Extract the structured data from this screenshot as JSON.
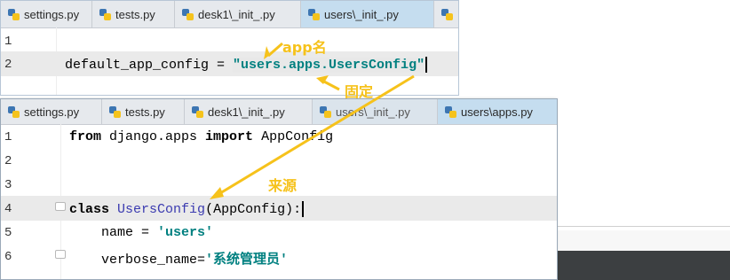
{
  "editor_top": {
    "tabs": [
      {
        "label": "settings.py",
        "active": false
      },
      {
        "label": "tests.py",
        "active": false
      },
      {
        "label": "desk1\\_init_.py",
        "active": false
      },
      {
        "label": "users\\_init_.py",
        "active": true
      },
      {
        "label": "",
        "active": false
      }
    ],
    "lines": [
      {
        "number": "1",
        "text": ""
      },
      {
        "number": "2",
        "lhs": "default_app_config = ",
        "string": "\"users.apps.UsersConfig\""
      }
    ]
  },
  "editor_bottom": {
    "tabs": [
      {
        "label": "settings.py",
        "active": false
      },
      {
        "label": "tests.py",
        "active": false
      },
      {
        "label": "desk1\\_init_.py",
        "active": false
      },
      {
        "label": "users\\_init_.py",
        "active": false
      },
      {
        "label": "users\\apps.py",
        "active": true
      }
    ],
    "lines": [
      {
        "number": "1",
        "kw1": "from",
        "mod": " django.apps ",
        "kw2": "import",
        "rest": " AppConfig"
      },
      {
        "number": "2"
      },
      {
        "number": "3"
      },
      {
        "number": "4",
        "kw": "class",
        "cls": "UsersConfig",
        "rest": "(AppConfig):"
      },
      {
        "number": "5",
        "lhs": "name = ",
        "string": "'users'"
      },
      {
        "number": "6",
        "lhs": "verbose_name=",
        "string": "'系统管理员'"
      }
    ]
  },
  "annotations": {
    "app_name": "app名",
    "fixed": "固定",
    "source": "来源",
    "color": "#f6c21b"
  }
}
